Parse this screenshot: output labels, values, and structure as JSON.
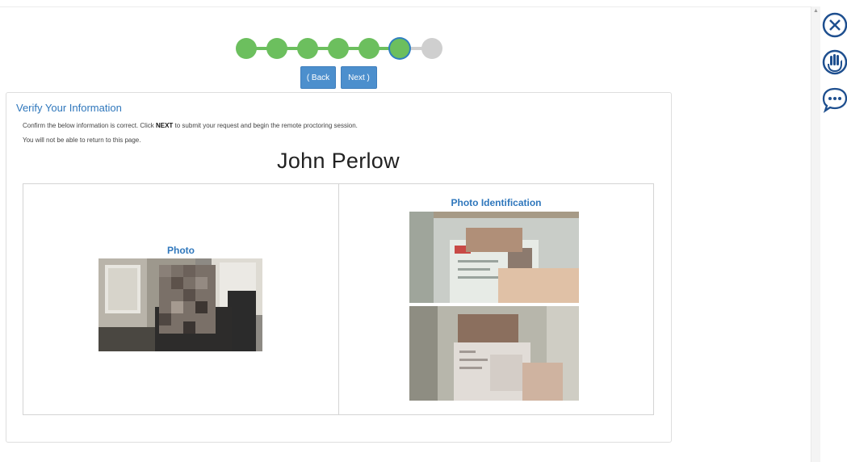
{
  "progress": {
    "steps": [
      "done",
      "done",
      "done",
      "done",
      "done",
      "current",
      "todo"
    ]
  },
  "nav": {
    "back_label": "( Back",
    "next_label": "Next )"
  },
  "verify": {
    "title": "Verify Your Information",
    "line1_pre": "Confirm the below information is correct. Click ",
    "line1_bold": "NEXT",
    "line1_post": " to submit your request and begin the remote proctoring session.",
    "line2": "You will not be able to return to this page.",
    "name": "John Perlow"
  },
  "photo": {
    "label": "Photo"
  },
  "photo_id": {
    "label": "Photo Identification"
  },
  "side": {
    "icons": [
      "close-circle-icon",
      "raise-hand-icon",
      "chat-icon"
    ]
  },
  "colors": {
    "accent": "#2f77bc",
    "done": "#6cbf5e",
    "todo": "#cfcfcf",
    "button": "#4c8fcd"
  }
}
